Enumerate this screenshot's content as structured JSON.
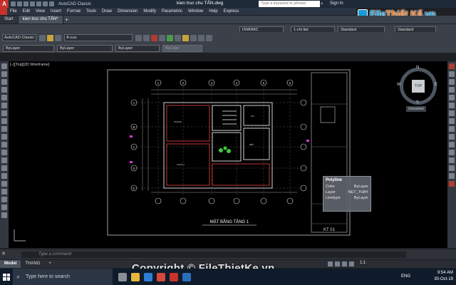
{
  "titlebar": {
    "workspace": "AutoCAD Classic",
    "file_title": "kien truc chu TẤN.dwg",
    "search_placeholder": "Type a keyword or phrase",
    "sign_in": "Sign In"
  },
  "watermark": {
    "brand_a": "File",
    "brand_b": "Thiết Kế",
    "brand_c": ".vn"
  },
  "menu": [
    "File",
    "Edit",
    "View",
    "Insert",
    "Format",
    "Tools",
    "Draw",
    "Dimension",
    "Modify",
    "Parametric",
    "Window",
    "Help",
    "Express"
  ],
  "doc_tabs": [
    {
      "label": "Start"
    },
    {
      "label": "kien truc chu TẤN*"
    }
  ],
  "toolbar": {
    "workspace_select": "AutoCAD Classic",
    "layer_select": "A-cua",
    "dimstyle": "DIMDMC",
    "text_style": "1-chi tiet",
    "table_style": "Standard",
    "mleader_style": "Standard"
  },
  "properties": {
    "color": "ByLayer",
    "linetype": "ByLayer",
    "lineweight": "ByLayer",
    "plotstyle": "ByColor"
  },
  "viewport_label": "[−][Top][2D Wireframe]",
  "viewcube": {
    "top": "TOP",
    "n": "N",
    "s": "S",
    "w": "W",
    "e": "E",
    "wcs": "Unnamed"
  },
  "drawing": {
    "plan_title": "MẶT BẰNG TẦNG 1",
    "title_block_code": "KT 01",
    "grid_labels_top": [
      "1",
      "2",
      "3",
      "4",
      "5",
      "6"
    ],
    "grid_labels_side": [
      "A",
      "B",
      "C",
      "D",
      "E"
    ]
  },
  "quick_props": {
    "title": "Polyline",
    "rows": [
      {
        "k": "Color",
        "v": "ByLayer"
      },
      {
        "k": "Layer",
        "v": "NET_THAY"
      },
      {
        "k": "Linetype",
        "v": "ByLayer"
      }
    ]
  },
  "command": {
    "placeholder": "Type a command"
  },
  "layout_tabs": [
    {
      "label": "Model"
    },
    {
      "label": "THANG"
    }
  ],
  "status": {
    "scale": "1:1"
  },
  "taskbar": {
    "search_placeholder": "Type here to search",
    "lang": "ENG",
    "time": "9:54 AM",
    "date": "30-Oct-19"
  },
  "copyright": "Copyright © FileThietKe.vn",
  "colors": {
    "accent_red": "#c7332b",
    "canvas": "#000000",
    "brand_blue": "#1b9ad8",
    "brand_orange": "#e8792a"
  }
}
